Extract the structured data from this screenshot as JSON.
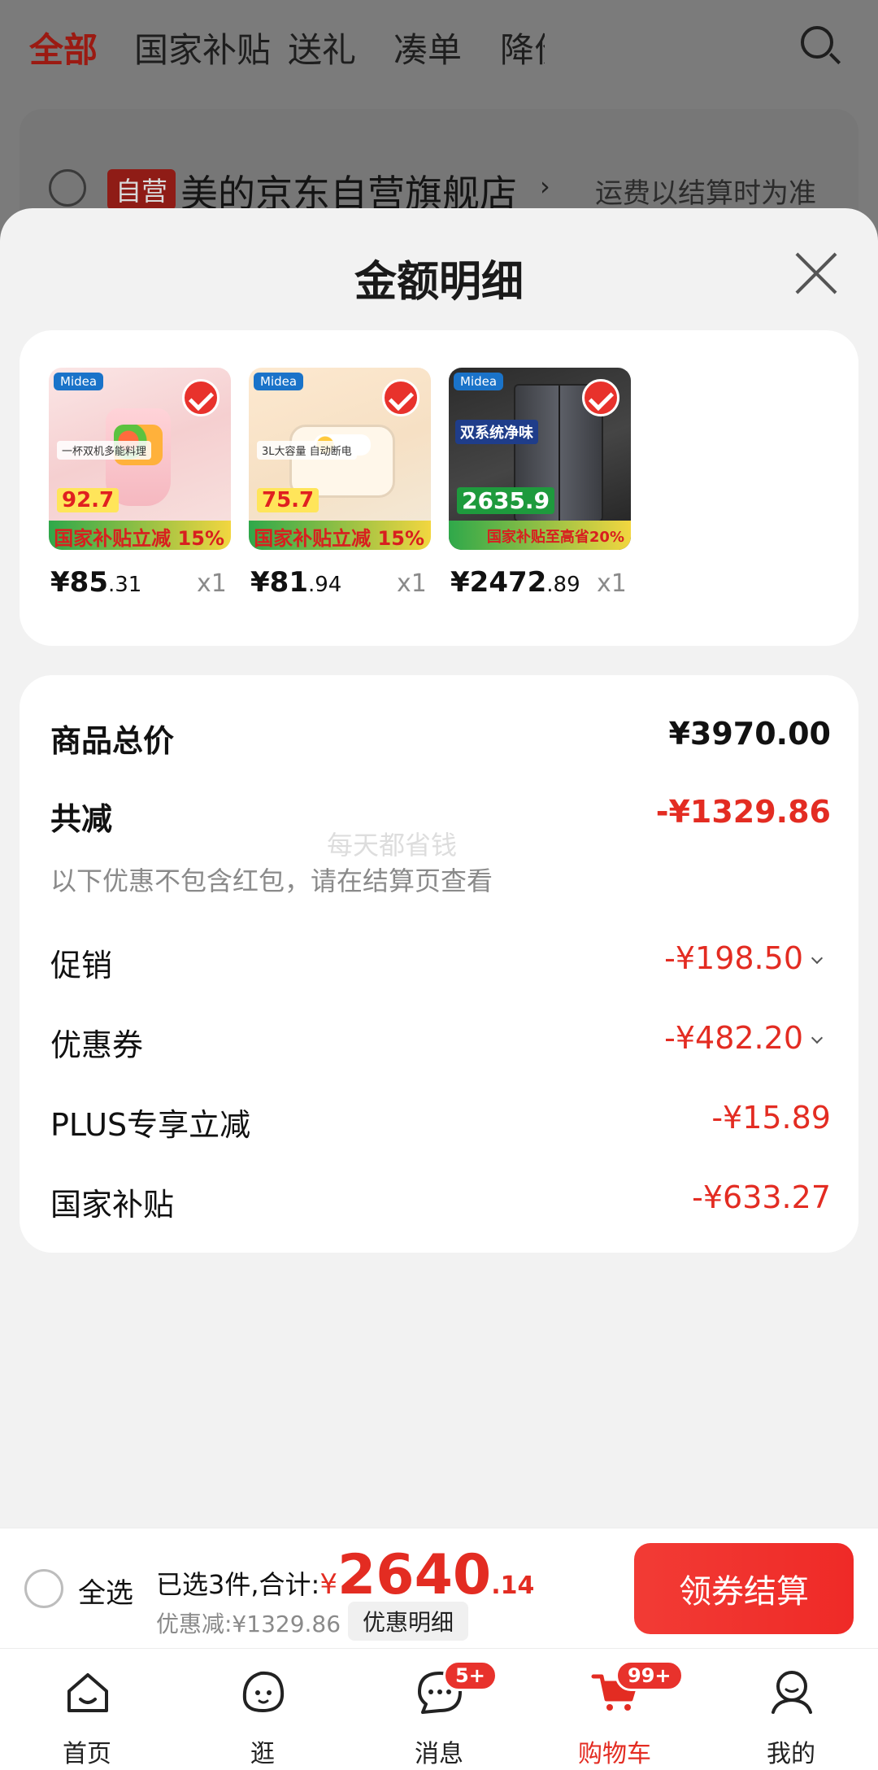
{
  "top_tabs": [
    "全部",
    "国家补贴",
    "送礼",
    "凑单",
    "降价"
  ],
  "store": {
    "badge": "自营",
    "name": "美的京东自营旗舰店",
    "arrow": "›",
    "shipping_note": "运费以结算时为准"
  },
  "sheet": {
    "title": "金额明细"
  },
  "products": [
    {
      "brand": "Midea",
      "spec": "一杯双机多能料理",
      "promo_price": "92.7",
      "tag": "国家补贴立减 15%",
      "price_int": "¥85",
      "price_dec": ".31",
      "qty": "x1"
    },
    {
      "brand": "Midea",
      "spec": "3L大容量 自动断电",
      "promo_price": "75.7",
      "tag": "国家补贴立减 15%",
      "price_int": "¥81",
      "price_dec": ".94",
      "qty": "x1"
    },
    {
      "brand": "Midea",
      "spec": "双系统净味",
      "promo_price": "2635.9",
      "tag": "国家补贴至高省20%",
      "price_int": "¥2472",
      "price_dec": ".89",
      "qty": "x1"
    }
  ],
  "amounts": {
    "total_label": "商品总价",
    "total_value": "¥3970.00",
    "reduce_label": "共减",
    "reduce_value": "-¥1329.86",
    "watermark": "每天都省钱",
    "note": "以下优惠不包含红包，请在结算页查看",
    "items": [
      {
        "label": "促销",
        "value": "-¥198.50"
      },
      {
        "label": "优惠券",
        "value": "-¥482.20"
      },
      {
        "label": "PLUS专享立减",
        "value": "-¥15.89"
      },
      {
        "label": "国家补贴",
        "value": "-¥633.27"
      }
    ]
  },
  "checkout": {
    "select_all": "全选",
    "summary_prefix": "已选3件,合计:",
    "currency": "¥",
    "total_int": "2640",
    "total_dec": ".14",
    "discount_text": "优惠减:¥1329.86",
    "detail_button": "优惠明细",
    "pay_button": "领券结算"
  },
  "tabbar": [
    {
      "label": "首页",
      "icon": "home-icon"
    },
    {
      "label": "逛",
      "icon": "face-icon"
    },
    {
      "label": "消息",
      "icon": "message-icon",
      "badge": "5+"
    },
    {
      "label": "购物车",
      "icon": "cart-icon",
      "badge": "99+",
      "active": true
    },
    {
      "label": "我的",
      "icon": "user-icon"
    }
  ],
  "colors": {
    "accent_red": "#e32c22",
    "overlay_gray": "#7b7b7b"
  }
}
